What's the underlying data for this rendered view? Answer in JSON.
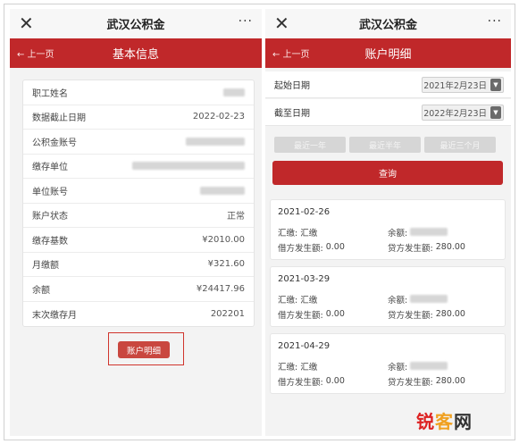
{
  "left": {
    "topbar": {
      "close": "✕",
      "title": "武汉公积金",
      "more": "···"
    },
    "header": {
      "back": "← 上一页",
      "title": "基本信息"
    },
    "rows": [
      {
        "label": "职工姓名",
        "value": ""
      },
      {
        "label": "数据截止日期",
        "value": "2022-02-23"
      },
      {
        "label": "公积金账号",
        "value": ""
      },
      {
        "label": "缴存单位",
        "value": ""
      },
      {
        "label": "单位账号",
        "value": ""
      },
      {
        "label": "账户状态",
        "value": "正常"
      },
      {
        "label": "缴存基数",
        "value": "¥2010.00"
      },
      {
        "label": "月缴额",
        "value": "¥321.60"
      },
      {
        "label": "余额",
        "value": "¥24417.96"
      },
      {
        "label": "末次缴存月",
        "value": "202201"
      }
    ],
    "detail_button": "账户明细"
  },
  "right": {
    "topbar": {
      "close": "✕",
      "title": "武汉公积金",
      "more": "···"
    },
    "header": {
      "back": "← 上一页",
      "title": "账户明细"
    },
    "start_label": "起始日期",
    "start_value": "2021年2月23日",
    "end_label": "截至日期",
    "end_value": "2022年2月23日",
    "ranges": [
      "最近一年",
      "最近半年",
      "最近三个月"
    ],
    "query": "查询",
    "records": [
      {
        "date": "2021-02-26",
        "type_label": "汇缴:",
        "type_value": "汇缴",
        "balance_label": "余额:",
        "debit_label": "借方发生额:",
        "debit_value": "0.00",
        "credit_label": "贷方发生额:",
        "credit_value": "280.00"
      },
      {
        "date": "2021-03-29",
        "type_label": "汇缴:",
        "type_value": "汇缴",
        "balance_label": "余额:",
        "debit_label": "借方发生额:",
        "debit_value": "0.00",
        "credit_label": "贷方发生额:",
        "credit_value": "280.00"
      },
      {
        "date": "2021-04-29",
        "type_label": "汇缴:",
        "type_value": "汇缴",
        "balance_label": "余额:",
        "debit_label": "借方发生额:",
        "debit_value": "0.00",
        "credit_label": "贷方发生额:",
        "credit_value": "280.00"
      }
    ]
  },
  "watermark": {
    "part1": "锐",
    "part2": "客",
    "part3": "网"
  },
  "colors": {
    "accent": "#c0282a",
    "highlight_border": "#d0342c"
  }
}
